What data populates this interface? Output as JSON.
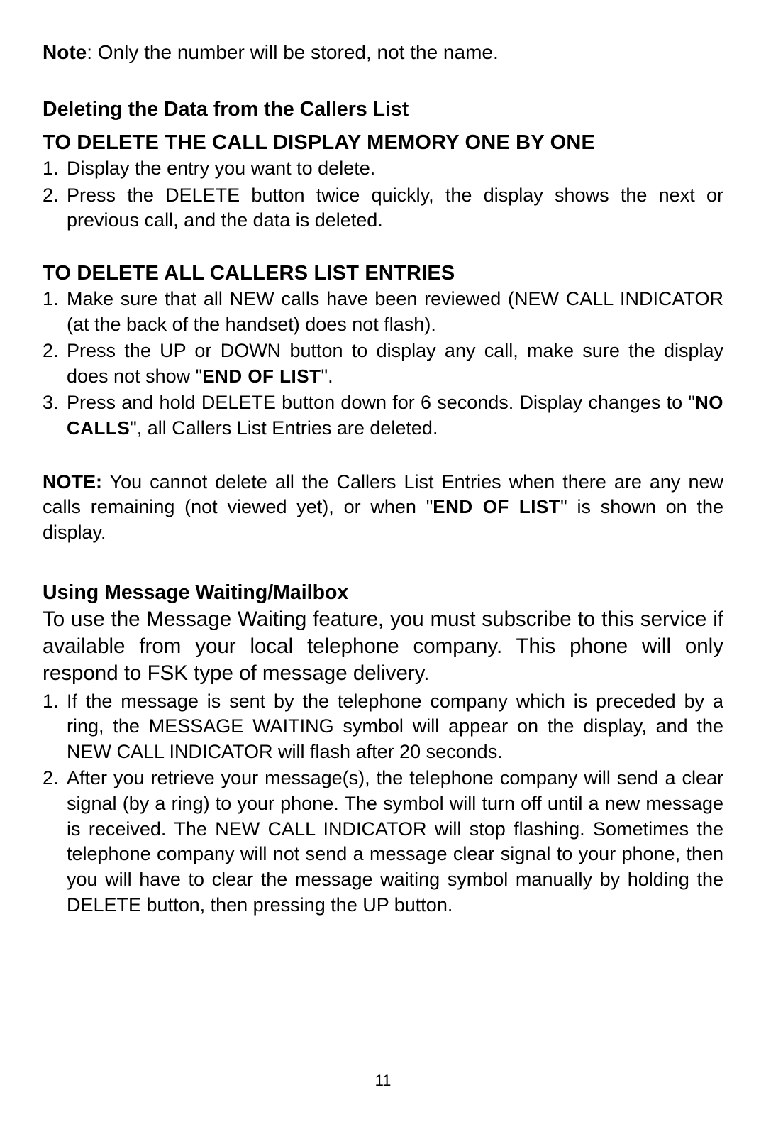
{
  "note1": {
    "label": "Note",
    "text": ": Only the number will be stored, not the name."
  },
  "subheading1": "Deleting the Data from the Callers List",
  "sectionA": {
    "heading": "TO DELETE THE CALL DISPLAY MEMORY ONE BY ONE",
    "items": [
      "Display the entry you want to delete.",
      "Press the DELETE button twice quickly, the display shows the next or previous call, and the data is deleted."
    ]
  },
  "sectionB": {
    "heading": "TO DELETE ALL CALLERS LIST ENTRIES",
    "items": [
      {
        "pre": "Make sure that all NEW calls have been reviewed (NEW CALL INDICATOR (at the back of the handset) does not flash)."
      },
      {
        "pre": "Press the UP or DOWN button to display any call, make sure the display does not show \"",
        "lcd": "END OF LIST",
        "post": "\"."
      },
      {
        "pre": "Press and hold DELETE button down for 6 seconds. Display changes to \"",
        "lcd": "NO CALLS",
        "post": "\", all Callers List Entries are deleted."
      }
    ]
  },
  "note2": {
    "label": "NOTE:",
    "pre": " You cannot delete all the Callers List Entries when there are any new calls remaining (not viewed yet), or when \"",
    "lcd": "END OF LIST",
    "post": "\" is shown on the display."
  },
  "subheading2": "Using Message Waiting/Mailbox",
  "mailboxIntro": "To use the Message Waiting feature, you must subscribe to this service if available from your local telephone company. This phone will only respond to FSK type of message delivery.",
  "sectionC": {
    "items": [
      "If the message is sent by the telephone company which is preceded by a ring, the MESSAGE WAITING symbol  will appear on the display, and the NEW CALL INDICATOR will flash after 20 seconds.",
      "After you retrieve your message(s), the telephone company will send a clear signal (by a ring) to your phone. The symbol  will turn off until a new message is received. The NEW CALL INDICATOR will stop flashing. Sometimes the telephone company will not send a message clear signal to your phone, then you will have to clear the message waiting symbol manually by holding the DELETE button, then pressing the UP button."
    ]
  },
  "pageNumber": "11"
}
